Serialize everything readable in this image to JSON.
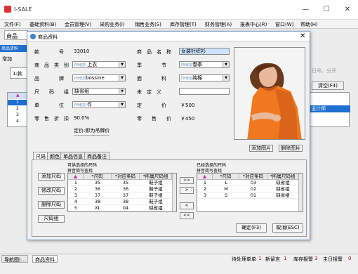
{
  "app": {
    "title": "I-SALE",
    "window_controls": [
      "—",
      "☐",
      "✕"
    ]
  },
  "menu": [
    "文件(F)",
    "基础资料(B)",
    "会员管理(V)",
    "采购业务(I)",
    "销售业务(S)",
    "库存管理(T)",
    "财务管理(A)",
    "报表中心(R)",
    "窗口(W)",
    "帮助(H)"
  ],
  "background": {
    "tab": "商品",
    "bar_label": "商品资料",
    "tool_label": "增加",
    "search_value": "1:款",
    "grid_rows": [
      "1",
      "2",
      "3",
      "4"
    ],
    "right_hint": "日号、分开",
    "clear_button": "清空(F4)",
    "right_row": "设计师"
  },
  "dialog": {
    "title": "商品资料",
    "labels": {
      "style_no": "款　　　　号",
      "name": "商　品　名　称",
      "category": "商　品　类　别",
      "season": "季　　　　节",
      "brand": "品　　　　牌",
      "fabric": "面　　　　料",
      "size_group": "尺　　码　　组",
      "undefined": "未　定　义",
      "unit": "单　　　　位",
      "fixed_price": "定　　　　价",
      "retail_discount": "零　售　折　扣",
      "retail_price": "零　　售　　价"
    },
    "values": {
      "style_no": "33010",
      "name": "女装针织衫",
      "category": "上衣",
      "season": "春季",
      "brand": "bossine",
      "fabric": "纯棉",
      "size_group": "缺省组",
      "undefined": "",
      "unit": "件",
      "fixed_price": "￥500",
      "retail_discount": "90.0%",
      "retail_price": "￥450",
      "price_note": "定价:即为吊牌价"
    },
    "field_prefix": "F8增加",
    "photo_buttons": [
      "添加图片",
      "删除图片"
    ],
    "tabs": [
      "尺码",
      "颜色",
      "单品信息",
      "商品备注"
    ],
    "active_tab": "尺码",
    "left_panel": {
      "title": "可供选择的尺码",
      "subtitle": "拼音简写查找",
      "buttons": [
        "添加尺码",
        "修改尺码",
        "删除尺码",
        "尺码组"
      ],
      "columns": [
        "▲",
        "*尺码",
        "*对应条码",
        "*所属尺码组"
      ],
      "rows": [
        [
          "1",
          "35",
          "35",
          "鞋子组"
        ],
        [
          "2",
          "36",
          "36",
          "鞋子组"
        ],
        [
          "3",
          "37",
          "37",
          "鞋子组"
        ],
        [
          "4",
          "38",
          "38",
          "鞋子组"
        ],
        [
          "5",
          "XL",
          "04",
          "缺省组"
        ]
      ]
    },
    "move_buttons": [
      ">>",
      ">",
      "<",
      "<<"
    ],
    "right_panel": {
      "title": "已经选择的尺码",
      "subtitle": "拼音简写查找",
      "columns": [
        "▲",
        "*尺码",
        "*对应条码",
        "*所属尺码组"
      ],
      "rows": [
        [
          "1",
          "L",
          "03",
          "缺省组"
        ],
        [
          "2",
          "M",
          "02",
          "缺省组"
        ],
        [
          "3",
          "S",
          "01",
          "缺省组"
        ]
      ]
    },
    "ok_button": "确定(F3)",
    "cancel_button": "取消(ESC)"
  },
  "taskbar": {
    "items": [
      "导航图(...",
      "商品资料"
    ],
    "status": [
      "待处理单单",
      "1",
      "新留言",
      "1",
      "库存报警",
      "3",
      "主日报警",
      "0"
    ]
  },
  "colors": {
    "selection": "#cde3ff",
    "highlight": "#1e6fd0",
    "grid_marker": "#d0208f"
  }
}
